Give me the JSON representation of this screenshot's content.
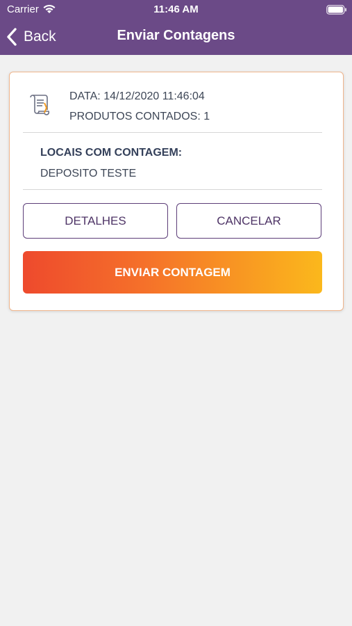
{
  "status_bar": {
    "carrier": "Carrier",
    "time": "11:46 AM"
  },
  "nav": {
    "back_label": "Back",
    "title": "Enviar Contagens"
  },
  "card": {
    "date_line": "DATA: 14/12/2020 11:46:04",
    "count_line": "PRODUTOS CONTADOS: 1",
    "locais_title": "LOCAIS COM CONTAGEM:",
    "locais_value": "DEPOSITO TESTE",
    "detalhes_label": "DETALHES",
    "cancelar_label": "CANCELAR",
    "enviar_label": "ENVIAR CONTAGEM",
    "icon": "document-scroll-icon"
  },
  "colors": {
    "header": "#6b4a87",
    "card_border": "#efb58c",
    "button_outline": "#5c3d78",
    "gradient_start": "#ee4a2d",
    "gradient_end": "#fbb81c"
  }
}
